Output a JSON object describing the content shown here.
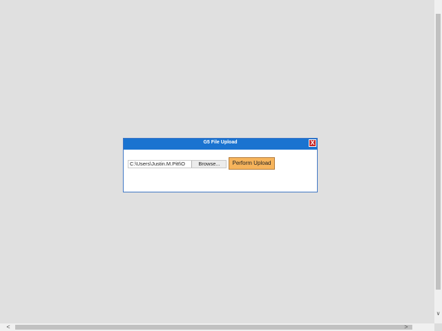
{
  "dialog": {
    "title": "G5 File Upload",
    "close_label": "X",
    "file_input": {
      "value": "C:\\Users\\Justin.M.Pitt\\O",
      "browse_label": "Browse..."
    },
    "upload_button_label": "Perform Upload"
  },
  "scrollbars": {
    "down_arrow": "∨",
    "left_arrow": "<",
    "right_arrow": ">"
  },
  "colors": {
    "titlebar": "#1a73d0",
    "upload_button": "#f6b45c",
    "close_button": "#c62828",
    "background": "#e0e0e0"
  }
}
